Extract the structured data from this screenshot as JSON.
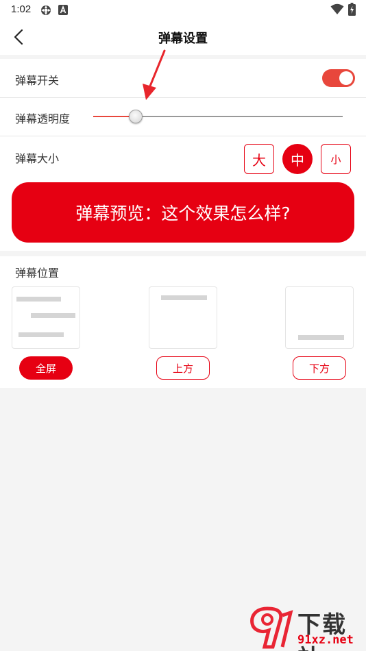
{
  "status_bar": {
    "time": "1:02"
  },
  "header": {
    "title": "弹幕设置"
  },
  "settings": {
    "danmaku_switch": {
      "label": "弹幕开关",
      "enabled": true
    },
    "opacity": {
      "label": "弹幕透明度",
      "value_fraction": 0.17
    },
    "size": {
      "label": "弹幕大小",
      "options": [
        "大",
        "中",
        "小"
      ],
      "selected": "中"
    }
  },
  "preview": {
    "text": "弹幕预览：这个效果怎么样?"
  },
  "position": {
    "label": "弹幕位置",
    "options": [
      "全屏",
      "上方",
      "下方"
    ],
    "selected": "全屏"
  },
  "watermark": {
    "brand": "下载站",
    "site": "91xz.net"
  },
  "colors": {
    "accent": "#e60012",
    "toggle_on": "#e8473c",
    "background": "#f4f4f4"
  },
  "icons": [
    "gear-icon",
    "font-a-icon",
    "wifi-icon",
    "battery-charging-icon",
    "back-arrow-icon"
  ]
}
